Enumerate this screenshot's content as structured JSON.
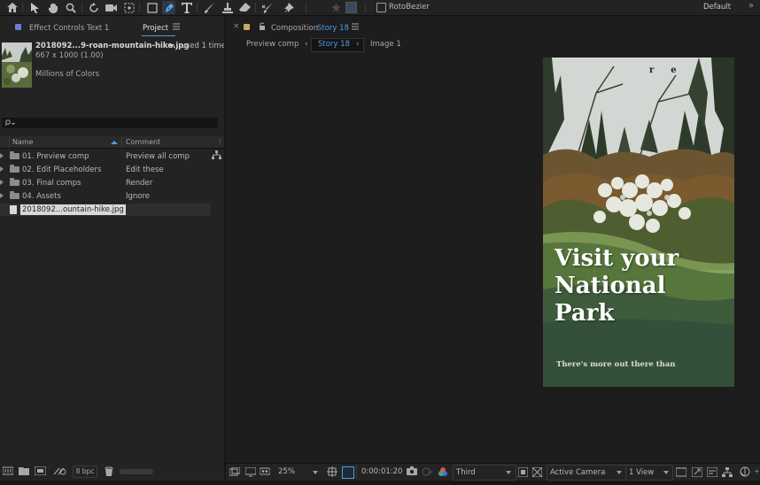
{
  "toolbar": {
    "rotobezier_label": "RotoBezier",
    "workspace_label": "Default"
  },
  "left_panel": {
    "tab_effect_controls": "Effect Controls Text 1",
    "tab_project": "Project",
    "asset_name": "2018092...9-roan-mountain-hike.jpg",
    "asset_used": ", used 1 time",
    "asset_dims": "667 x 1000 (1.00)",
    "asset_colors": "Millions of Colors",
    "search_placeholder": "",
    "col_name": "Name",
    "col_comment": "Comment",
    "items": [
      {
        "name": "01. Preview comp",
        "comment": "Preview all comp"
      },
      {
        "name": "02. Edit Placeholders",
        "comment": "Edit these"
      },
      {
        "name": "03. Final comps",
        "comment": "Render"
      },
      {
        "name": "04. Assets",
        "comment": "Ignore"
      }
    ],
    "selected_file": "2018092...ountain-hike.jpg",
    "bpc": "8 bpc"
  },
  "composition": {
    "tab_prefix": "Composition",
    "tab_name": "Story 18",
    "crumb_preview": "Preview comp",
    "crumb_story": "Story 18",
    "crumb_image": "Image 1",
    "frame_top_text": "r    e",
    "headline_line1": "Visit your",
    "headline_line2": "National",
    "headline_line3": "Park",
    "tagline": "There's more out there than"
  },
  "viewer_bar": {
    "zoom": "25%",
    "timecode": "0:00:01:20",
    "resolution": "Third",
    "camera": "Active Camera",
    "view": "1 View"
  },
  "colors": {
    "accent_blue": "#4a9ee8",
    "panel_bg": "#232323",
    "viewer_bg": "#1d1d1d",
    "green_dark": "#344d36",
    "green_light": "#6b8c4c"
  }
}
